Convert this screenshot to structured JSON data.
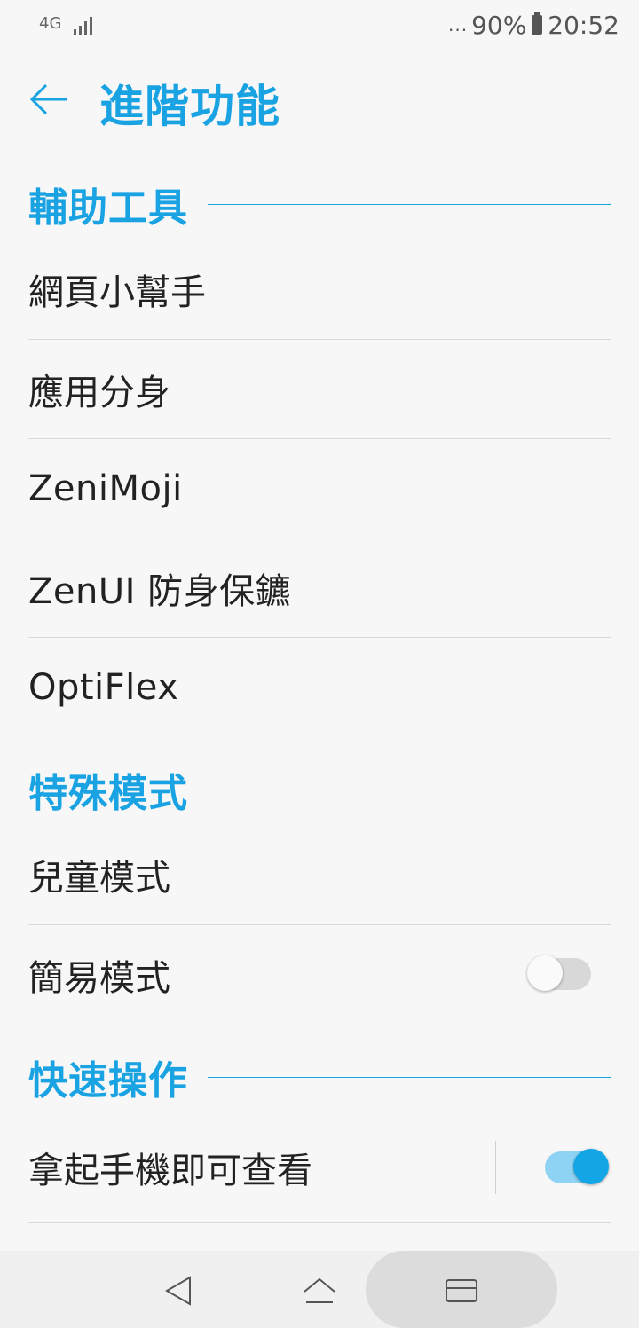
{
  "status_bar": {
    "network": "4G",
    "battery_percent": "90%",
    "time": "20:52",
    "dots": "..."
  },
  "header": {
    "title": "進階功能"
  },
  "sections": [
    {
      "title": "輔助工具",
      "items": [
        {
          "label": "網頁小幫手"
        },
        {
          "label": "應用分身"
        },
        {
          "label": "ZeniMoji"
        },
        {
          "label": "ZenUI 防身保鑣"
        },
        {
          "label": "OptiFlex"
        }
      ]
    },
    {
      "title": "特殊模式",
      "items": [
        {
          "label": "兒童模式"
        },
        {
          "label": "簡易模式",
          "toggle": false
        }
      ]
    },
    {
      "title": "快速操作",
      "items": [
        {
          "label": "拿起手機即可查看",
          "toggle": true
        }
      ]
    }
  ],
  "colors": {
    "accent": "#1aa3e2",
    "toggle_on": "#12a6e6"
  },
  "icons": {
    "back": "arrow-left-icon",
    "nav_back": "triangle-back-icon",
    "nav_home": "home-icon",
    "nav_recents": "recents-icon"
  }
}
